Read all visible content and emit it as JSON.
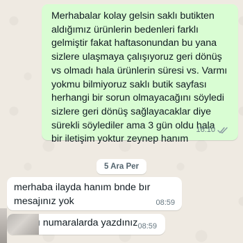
{
  "messages": {
    "outgoing": {
      "text": "Merhabalar kolay gelsin saklı butikten\naldığımız ürünlerin bedenleri farklı\ngelmiştir fakat haftasonundan bu yana\nsizlere ulaşmaya çalışıyoruz geri dönüş\nvs olmadı hala ürünlerin süresi vs. Varmı\nyokmu bilmiyoruz saklı butik sayfası\nherhangi bir sorun olmayacağını söyledi\nsizlere geri dönüş sağlayacaklar diye\nsürekli söylediler ama 3 gün oldu hala\nbir iletişim yoktur zeynep hanım",
      "time": "16:10",
      "status_icon": "double-check-read-icon"
    },
    "date_separator": "5 Ara Per",
    "incoming": [
      {
        "text": "merhaba ilayda hanım bnde bır\nmesajınız yok",
        "time": "08:59"
      },
      {
        "text": "ı numaralarda yazdınız",
        "time": "08:59"
      }
    ]
  },
  "colors": {
    "chat_background": "#efeae2",
    "outgoing_bubble": "#d9fdd3",
    "incoming_bubble": "#ffffff",
    "meta_text": "#667781"
  }
}
